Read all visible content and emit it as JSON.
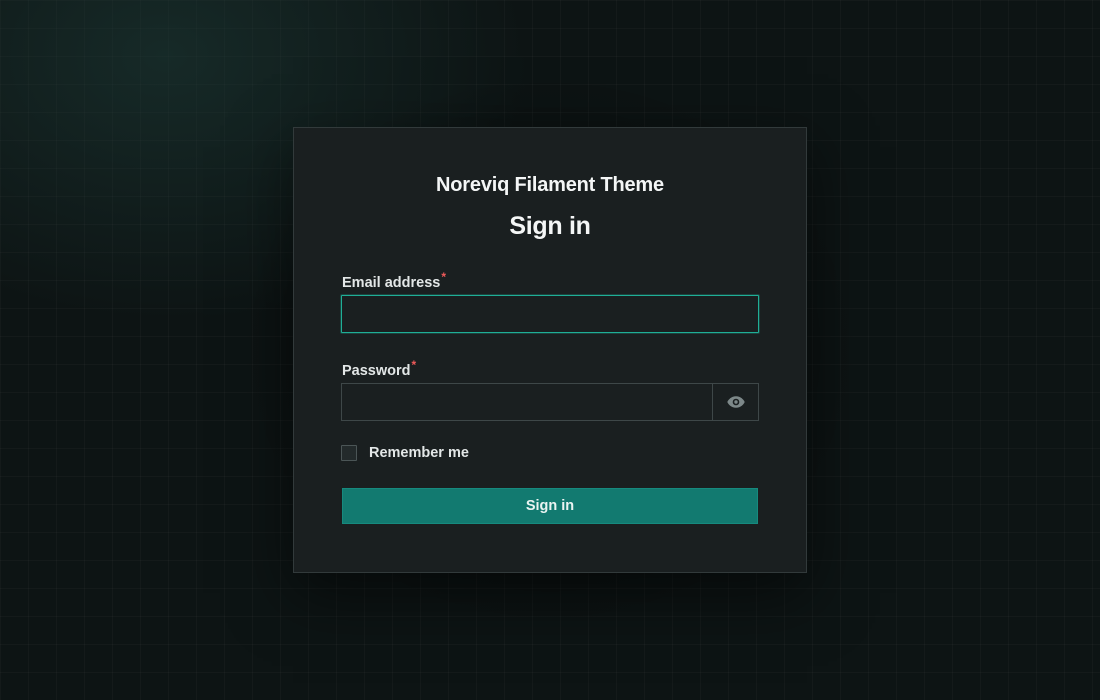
{
  "app": {
    "title": "Noreviq Filament Theme"
  },
  "form": {
    "heading": "Sign in",
    "email": {
      "label": "Email address",
      "required_marker": "*",
      "value": "",
      "placeholder": ""
    },
    "password": {
      "label": "Password",
      "required_marker": "*",
      "value": "",
      "placeholder": "",
      "reveal_icon": "eye-icon"
    },
    "remember": {
      "label": "Remember me",
      "checked": false
    },
    "submit_label": "Sign in"
  },
  "colors": {
    "accent": "#1fae96",
    "button": "#127a70",
    "required": "#f05a5a",
    "background": "#0d1414",
    "card": "#1a1f20"
  }
}
